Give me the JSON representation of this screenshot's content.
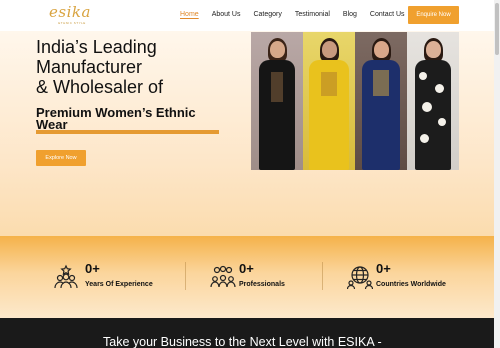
{
  "nav": {
    "logo": {
      "word": "esika",
      "tagline": "ETHNIC STYLE"
    },
    "items": [
      {
        "label": "Home",
        "active": true
      },
      {
        "label": "About Us",
        "active": false
      },
      {
        "label": "Category",
        "active": false
      },
      {
        "label": "Testimonial",
        "active": false
      },
      {
        "label": "Blog",
        "active": false
      },
      {
        "label": "Contact Us",
        "active": false
      }
    ],
    "enquire_label": "Enquire Now"
  },
  "hero": {
    "headline_lines": [
      "India’s Leading",
      "Manufacturer",
      "& Wholesaler of"
    ],
    "subheadline": "Premium Women’s Ethnic Wear",
    "explore_label": "Explore Now"
  },
  "stats": [
    {
      "value": "0+",
      "label": "Years Of Experience",
      "icon": "people-star-icon"
    },
    {
      "value": "0+",
      "label": "Professionals",
      "icon": "team-group-icon"
    },
    {
      "value": "0+",
      "label": "Countries Worldwide",
      "icon": "globe-people-icon"
    }
  ],
  "cta": {
    "text": "Take your Business to the Next Level with ESIKA -"
  },
  "colors": {
    "accent": "#f0a02e",
    "dark_band": "#1a1a1a",
    "active_link": "#e08a2c"
  }
}
